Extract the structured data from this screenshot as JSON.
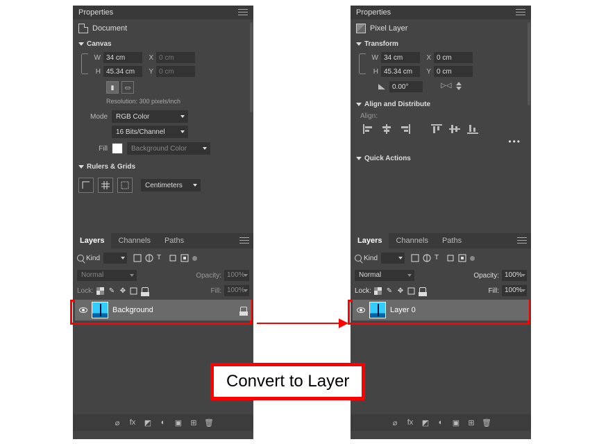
{
  "left": {
    "properties_title": "Properties",
    "type_label": "Document",
    "canvas": {
      "title": "Canvas",
      "w_label": "W",
      "w_value": "34 cm",
      "h_label": "H",
      "h_value": "45.34 cm",
      "x_label": "X",
      "x_value": "0 cm",
      "y_label": "Y",
      "y_value": "0 cm",
      "resolution": "Resolution: 300 pixels/inch",
      "mode_label": "Mode",
      "mode_value": "RGB Color",
      "depth_value": "16 Bits/Channel",
      "fill_label": "Fill",
      "fill_value": "Background Color"
    },
    "rulers": {
      "title": "Rulers & Grids",
      "unit": "Centimeters"
    },
    "layers": {
      "tab_layers": "Layers",
      "tab_channels": "Channels",
      "tab_paths": "Paths",
      "kind_label": "Kind",
      "blend": "Normal",
      "opacity_label": "Opacity:",
      "opacity_value": "100%",
      "lock_label": "Lock:",
      "fill_label": "Fill:",
      "fill_value": "100%",
      "layer_name": "Background"
    }
  },
  "right": {
    "properties_title": "Properties",
    "type_label": "Pixel Layer",
    "transform": {
      "title": "Transform",
      "w_label": "W",
      "w_value": "34 cm",
      "h_label": "H",
      "h_value": "45.34 cm",
      "x_label": "X",
      "x_value": "0 cm",
      "y_label": "Y",
      "y_value": "0 cm",
      "angle": "0.00°"
    },
    "align": {
      "title": "Align and Distribute",
      "label": "Align:"
    },
    "quick": {
      "title": "Quick Actions"
    },
    "layers": {
      "tab_layers": "Layers",
      "tab_channels": "Channels",
      "tab_paths": "Paths",
      "kind_label": "Kind",
      "blend": "Normal",
      "opacity_label": "Opacity:",
      "opacity_value": "100%",
      "lock_label": "Lock:",
      "fill_label": "Fill:",
      "fill_value": "100%",
      "layer_name": "Layer 0"
    }
  },
  "caption": "Convert to Layer"
}
